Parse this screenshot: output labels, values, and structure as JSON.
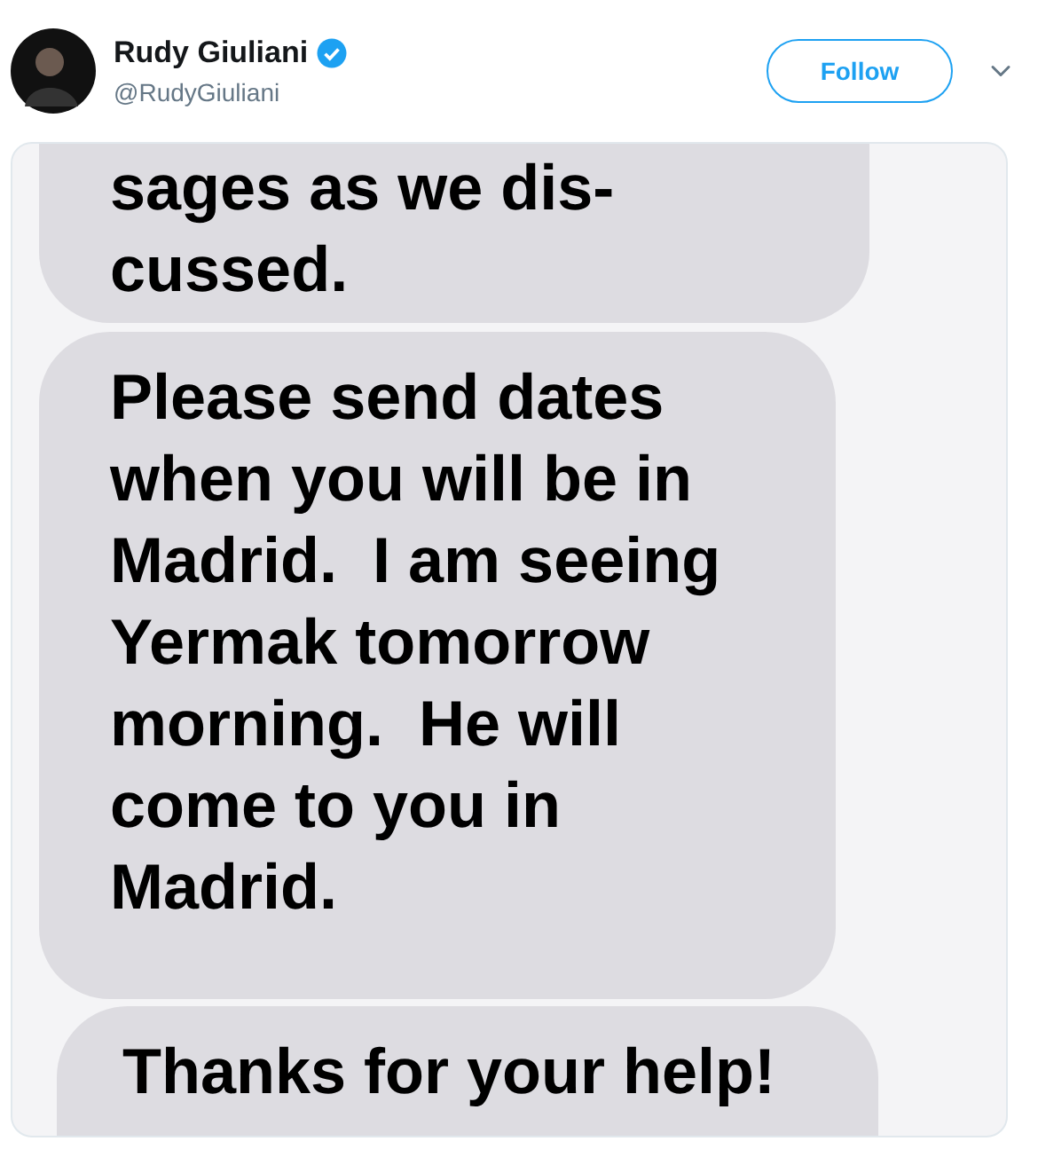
{
  "author": {
    "name": "Rudy Giuliani",
    "verified": true,
    "handle": "@RudyGiuliani"
  },
  "follow_button": "Follow",
  "messages": [
    {
      "lines": [
        "sages as we dis-",
        "cussed."
      ]
    },
    {
      "lines": [
        "Please send dates",
        "when you will be in",
        "Madrid.  I am seeing",
        "Yermak tomorrow",
        "morning.  He will",
        "come to you in",
        "Madrid."
      ]
    },
    {
      "lines": [
        "Thanks for your help!"
      ]
    }
  ]
}
